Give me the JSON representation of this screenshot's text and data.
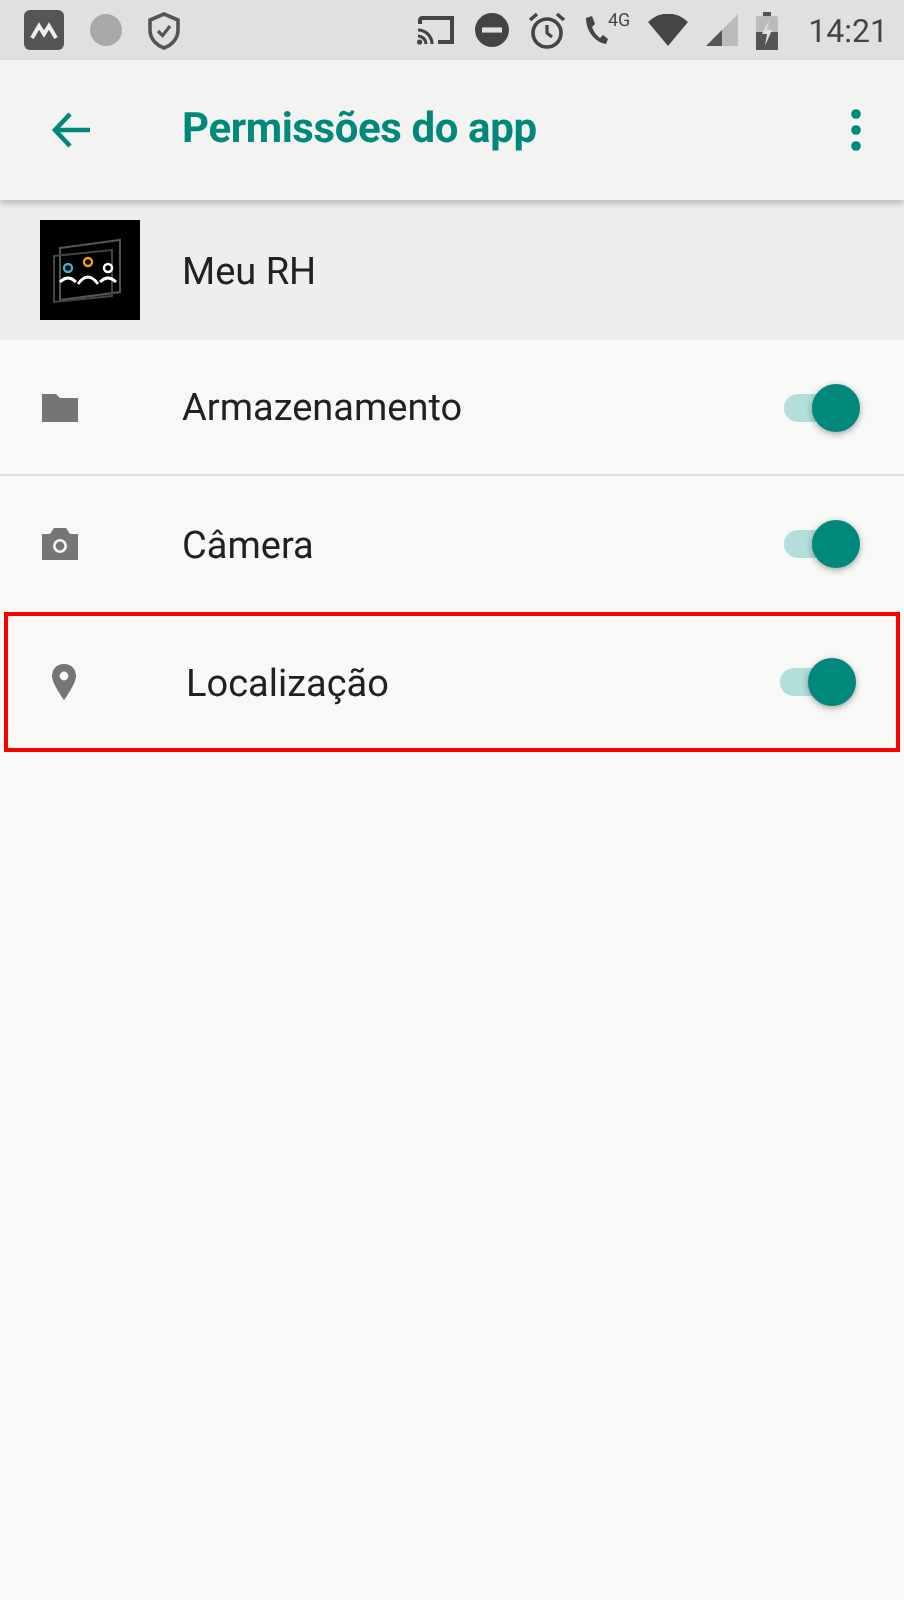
{
  "status_bar": {
    "time": "14:21",
    "network": "4G"
  },
  "app_bar": {
    "title": "Permissões do app"
  },
  "app": {
    "name": "Meu RH"
  },
  "permissions": [
    {
      "kind": "folder",
      "label": "Armazenamento",
      "on": true,
      "highlighted": false
    },
    {
      "kind": "camera",
      "label": "Câmera",
      "on": true,
      "highlighted": false
    },
    {
      "kind": "location",
      "label": "Localização",
      "on": true,
      "highlighted": true
    }
  ]
}
